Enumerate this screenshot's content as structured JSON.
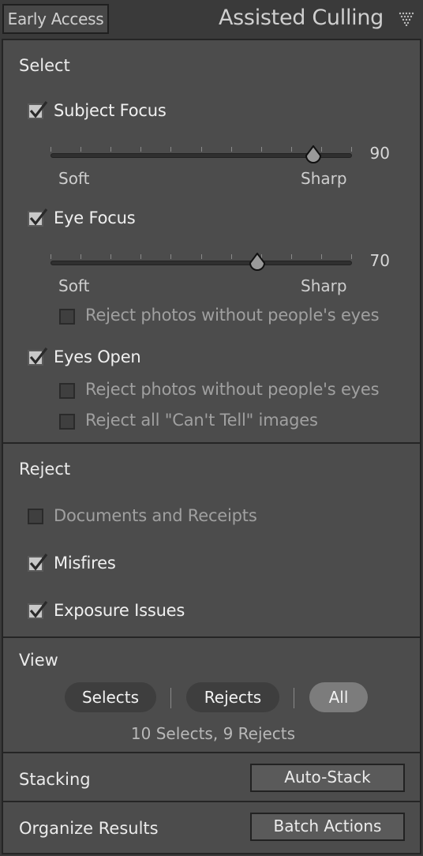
{
  "header": {
    "early_access": "Early Access",
    "title": "Assisted Culling",
    "collapse_icon": "triangle-down-dotted-icon"
  },
  "select": {
    "title": "Select",
    "subject_focus": {
      "label": "Subject Focus",
      "checked": true,
      "value": "90",
      "left_label": "Soft",
      "right_label": "Sharp"
    },
    "eye_focus": {
      "label": "Eye Focus",
      "checked": true,
      "value": "70",
      "left_label": "Soft",
      "right_label": "Sharp",
      "reject_no_eyes": {
        "label": "Reject photos without people's eyes",
        "checked": false
      }
    },
    "eyes_open": {
      "label": "Eyes Open",
      "checked": true,
      "reject_no_eyes": {
        "label": "Reject photos without people's eyes",
        "checked": false
      },
      "reject_cant_tell": {
        "label": "Reject all \"Can't Tell\" images",
        "checked": false
      }
    }
  },
  "reject": {
    "title": "Reject",
    "documents": {
      "label": "Documents and Receipts",
      "checked": false
    },
    "misfires": {
      "label": "Misfires",
      "checked": true
    },
    "exposure": {
      "label": "Exposure Issues",
      "checked": true
    }
  },
  "view": {
    "title": "View",
    "options": [
      "Selects",
      "Rejects",
      "All"
    ],
    "active": "All",
    "count": "10 Selects, 9 Rejects"
  },
  "stacking": {
    "title": "Stacking",
    "button": "Auto-Stack"
  },
  "organize": {
    "title": "Organize Results",
    "button": "Batch Actions"
  }
}
